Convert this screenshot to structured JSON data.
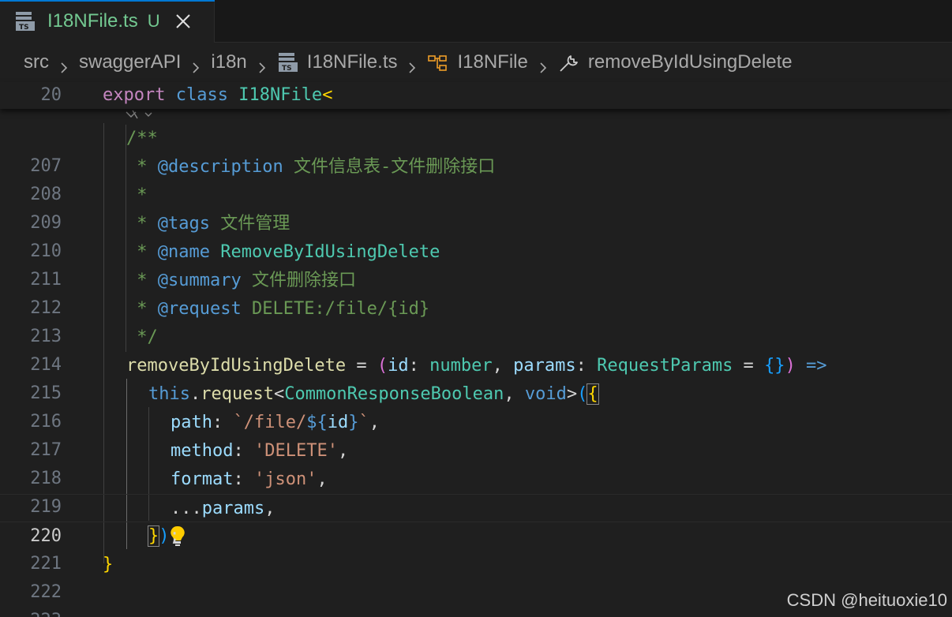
{
  "tab": {
    "title": "I18NFile.ts",
    "status": "U",
    "icon": "typescript-file-icon",
    "ts_label": "TS"
  },
  "breadcrumb": {
    "items": [
      "src",
      "swaggerAPI",
      "i18n",
      "I18NFile.ts",
      "I18NFile",
      "removeByIdUsingDelete"
    ]
  },
  "sticky": {
    "line_number": "20",
    "keyword1": "export",
    "keyword2": "class",
    "class_name": "I18NFile",
    "bracket": "<"
  },
  "code": {
    "line_numbers": [
      "207",
      "208",
      "209",
      "210",
      "211",
      "212",
      "213",
      "214",
      "215",
      "216",
      "217",
      "218",
      "219",
      "220",
      "221",
      "222",
      "223"
    ],
    "active_line": "220",
    "l207": "/**",
    "l208": {
      "star": " * ",
      "tag": "@description",
      "text": " 文件信息表-文件删除接口"
    },
    "l209": " *",
    "l210": {
      "star": " * ",
      "tag": "@tags",
      "text": " 文件管理"
    },
    "l211": {
      "star": " * ",
      "tag": "@name",
      "text": " RemoveByIdUsingDelete"
    },
    "l212": {
      "star": " * ",
      "tag": "@summary",
      "text": " 文件删除接口"
    },
    "l213": {
      "star": " * ",
      "tag": "@request",
      "text": " DELETE:/file/{id}"
    },
    "l214": " */",
    "l215": {
      "name": "removeByIdUsingDelete",
      "eq": " = ",
      "open": "(",
      "p1": "id",
      "colon1": ": ",
      "t1": "number",
      "comma": ", ",
      "p2": "params",
      "colon2": ": ",
      "t2": "RequestParams",
      "eq2": " = ",
      "obj": "{}",
      "close": ")",
      "arrow": " =>"
    },
    "l216": {
      "this": "this",
      "dot": ".",
      "fn": "request",
      "lt": "<",
      "type": "CommonResponseBoolean",
      "comma": ", ",
      "void": "void",
      "gt": ">",
      "paren": "(",
      "brace": "{"
    },
    "l217": {
      "key": "path",
      "colon": ": ",
      "tpl_start": "`/file/",
      "dollar": "$",
      "open": "{",
      "var": "id",
      "close": "}",
      "tpl_end": "`",
      "comma": ","
    },
    "l218": {
      "key": "method",
      "colon": ": ",
      "value": "'DELETE'",
      "comma": ","
    },
    "l219": {
      "key": "format",
      "colon": ": ",
      "value": "'json'",
      "comma": ","
    },
    "l220": {
      "spread": "...",
      "var": "params",
      "comma": ","
    },
    "l221": {
      "brace": "}",
      "paren": ")",
      "semi": ";"
    },
    "l222": "}"
  },
  "watermark": "CSDN @heituoxie10"
}
